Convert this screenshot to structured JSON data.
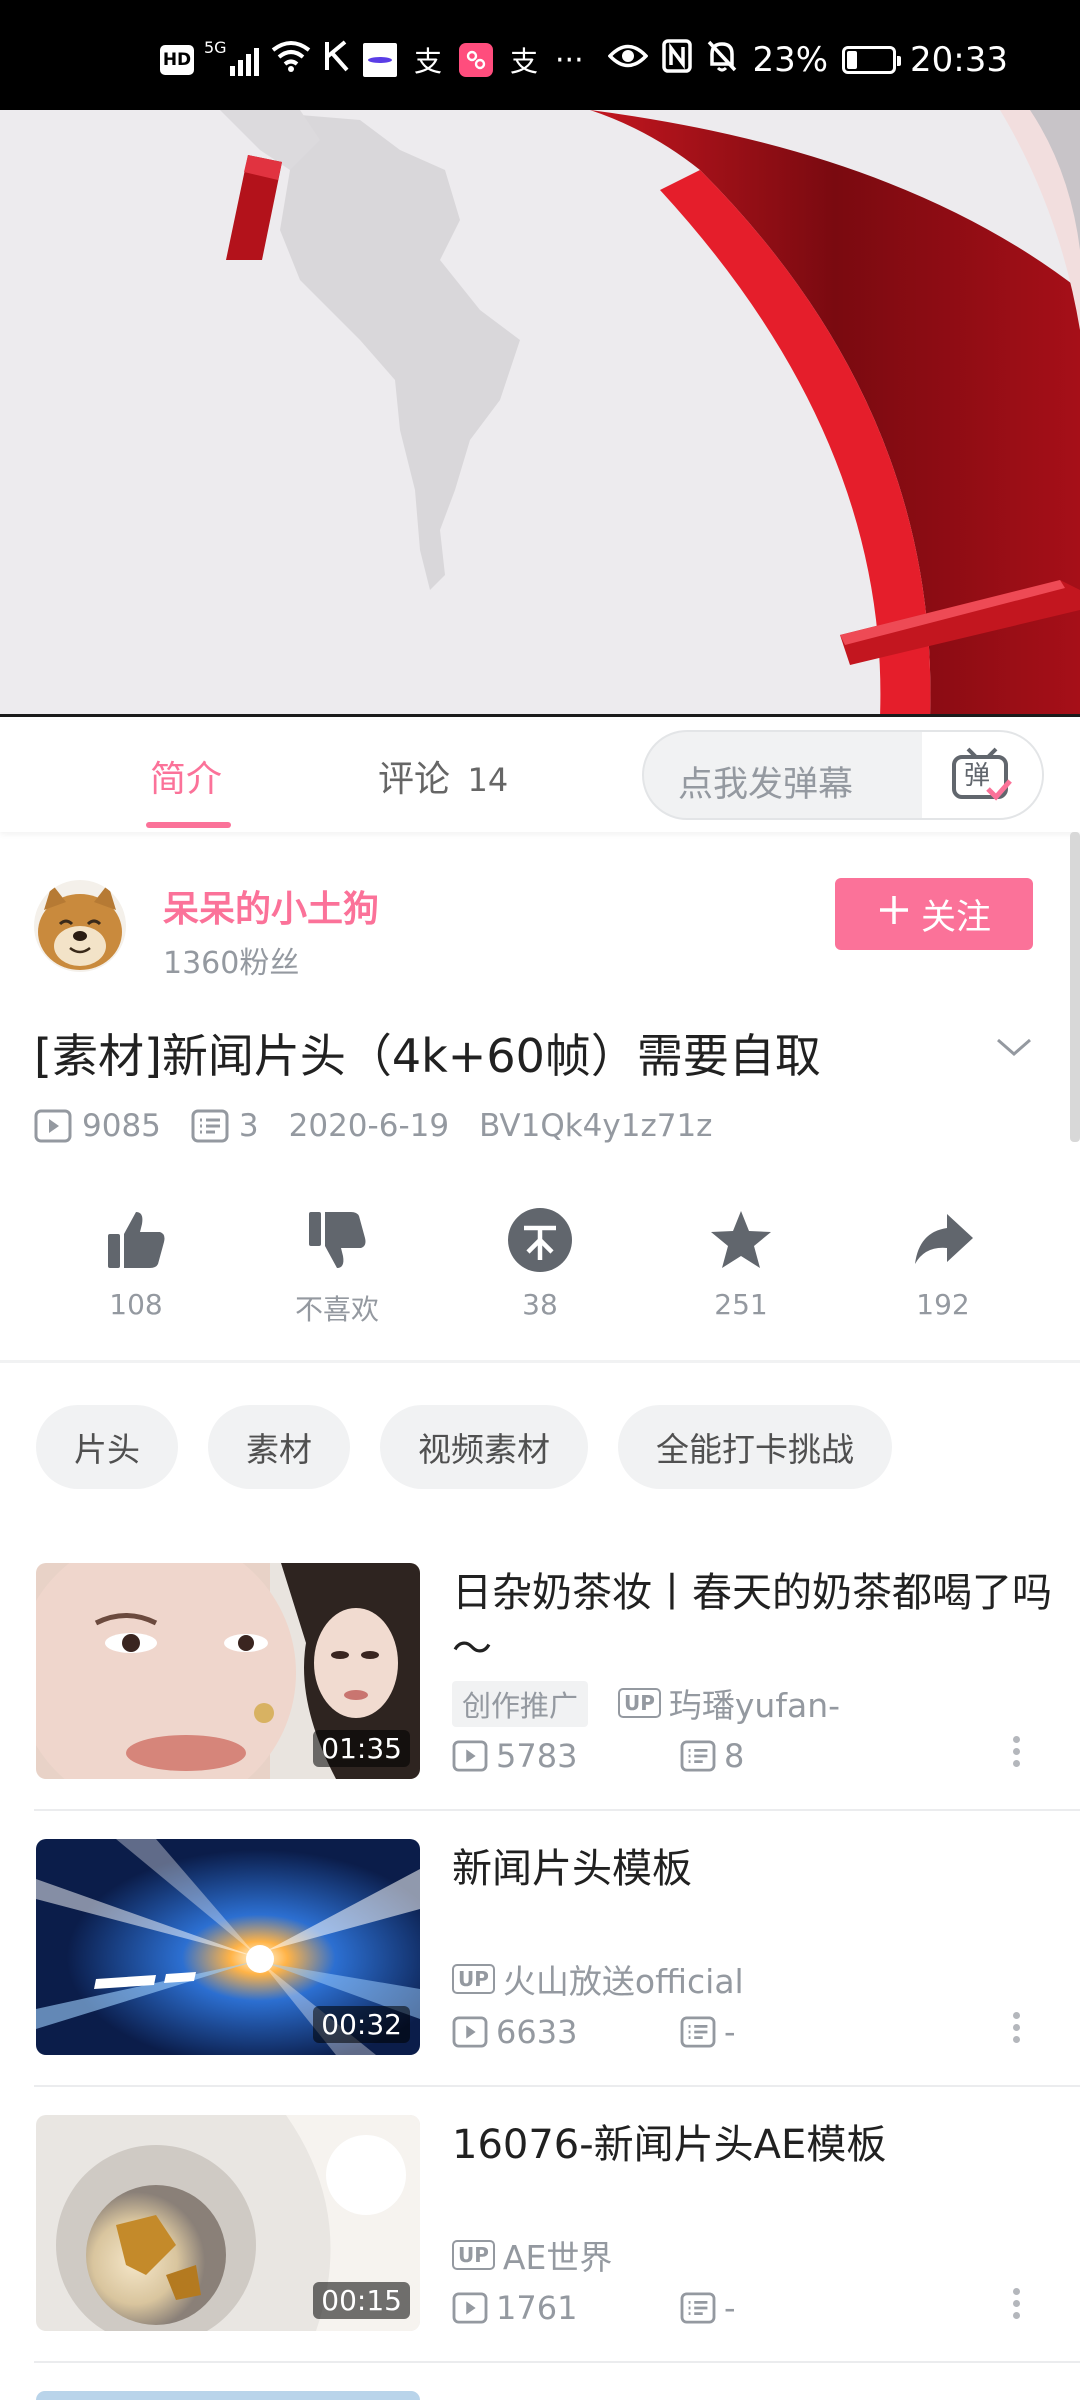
{
  "status_bar": {
    "hd": "HD",
    "network": "5G",
    "battery": "23%",
    "battery_level": 0.23,
    "time": "20:33",
    "more": "···",
    "app_glyph_1": "支",
    "app_glyph_2": "支"
  },
  "tabs": {
    "intro": "简介",
    "comments_label": "评论",
    "comments_count": "14",
    "danmaku_placeholder": "点我发弹幕",
    "danmaku_icon_char": "弹"
  },
  "uploader": {
    "name": "呆呆的小土狗",
    "fans": "1360粉丝",
    "follow_label": "关注"
  },
  "video": {
    "title": "[素材]新闻片头（4k+60帧）需要自取",
    "views": "9085",
    "danmaku": "3",
    "date": "2020-6-19",
    "bvid": "BV1Qk4y1z71z"
  },
  "actions": [
    {
      "name": "like",
      "label": "108"
    },
    {
      "name": "dislike",
      "label": "不喜欢"
    },
    {
      "name": "coin",
      "label": "38"
    },
    {
      "name": "favorite",
      "label": "251"
    },
    {
      "name": "share",
      "label": "192"
    }
  ],
  "tags": [
    "片头",
    "素材",
    "视频素材",
    "全能打卡挑战"
  ],
  "related": [
    {
      "title": "日杂奶茶妆丨春天的奶茶都喝了吗～",
      "ad_label": "创作推广",
      "up_badge": "UP",
      "uploader": "玙璠yufan-",
      "views": "5783",
      "danmaku": "8",
      "duration": "01:35"
    },
    {
      "title": "新闻片头模板",
      "up_badge": "UP",
      "uploader": "火山放送official",
      "views": "6633",
      "danmaku": "-",
      "duration": "00:32"
    },
    {
      "title": "16076-新闻片头AE模板",
      "up_badge": "UP",
      "uploader": "AE世界",
      "views": "1761",
      "danmaku": "-",
      "duration": "00:15"
    }
  ],
  "colors": {
    "accent": "#fb7299",
    "secondary_text": "#9499a0",
    "primary_text": "#212121",
    "chip_bg": "#f1f2f3",
    "video_red": "#b3121b"
  }
}
